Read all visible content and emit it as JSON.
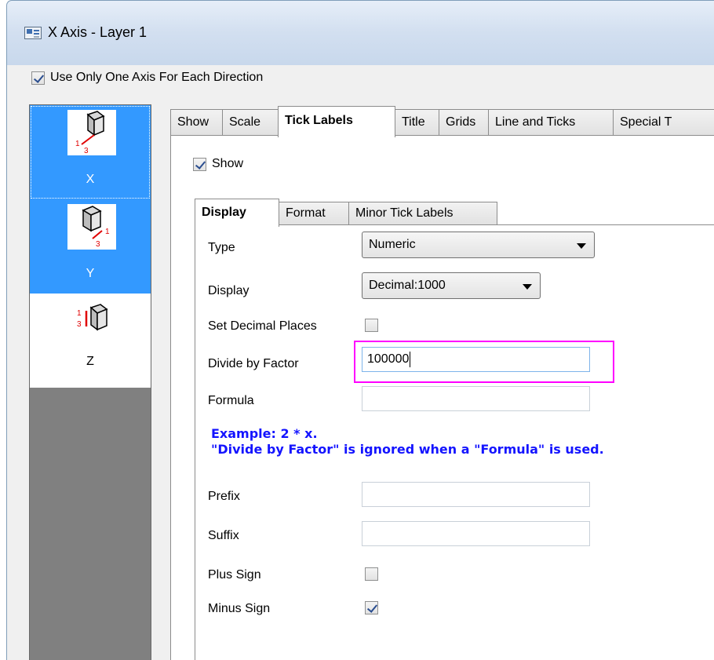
{
  "window": {
    "title": "X Axis - Layer 1"
  },
  "top_checkbox": {
    "label": "Use Only One Axis For Each Direction",
    "checked": true
  },
  "axes": [
    {
      "name": "X",
      "icon": "x-axis-cube-icon",
      "selected": true
    },
    {
      "name": "Y",
      "icon": "y-axis-cube-icon",
      "selected": true
    },
    {
      "name": "Z",
      "icon": "z-axis-cube-icon",
      "selected": false
    }
  ],
  "tabs": [
    {
      "label": "Show"
    },
    {
      "label": "Scale"
    },
    {
      "label": "Tick Labels",
      "active": true
    },
    {
      "label": "Title"
    },
    {
      "label": "Grids"
    },
    {
      "label": "Line and Ticks"
    },
    {
      "label": "Special T"
    }
  ],
  "show_checkbox": {
    "label": "Show",
    "checked": true
  },
  "subtabs": [
    {
      "label": "Display",
      "active": true
    },
    {
      "label": "Format"
    },
    {
      "label": "Minor Tick Labels"
    }
  ],
  "form": {
    "type_label": "Type",
    "type_value": "Numeric",
    "display_label": "Display",
    "display_value": "Decimal:1000",
    "decimal_places_label": "Set Decimal Places",
    "decimal_places_checked": false,
    "divide_label": "Divide by Factor",
    "divide_value": "100000",
    "formula_label": "Formula",
    "formula_value": "",
    "example_line1": "Example: 2 * x.",
    "example_line2": "\"Divide by Factor\" is ignored when a \"Formula\" is used.",
    "prefix_label": "Prefix",
    "prefix_value": "",
    "suffix_label": "Suffix",
    "suffix_value": "",
    "plus_sign_label": "Plus Sign",
    "plus_sign_checked": false,
    "minus_sign_label": "Minus Sign",
    "minus_sign_checked": true
  },
  "colors": {
    "selection": "#3399ff",
    "highlight_box": "#ff00ff",
    "example_text": "#1414ff"
  }
}
